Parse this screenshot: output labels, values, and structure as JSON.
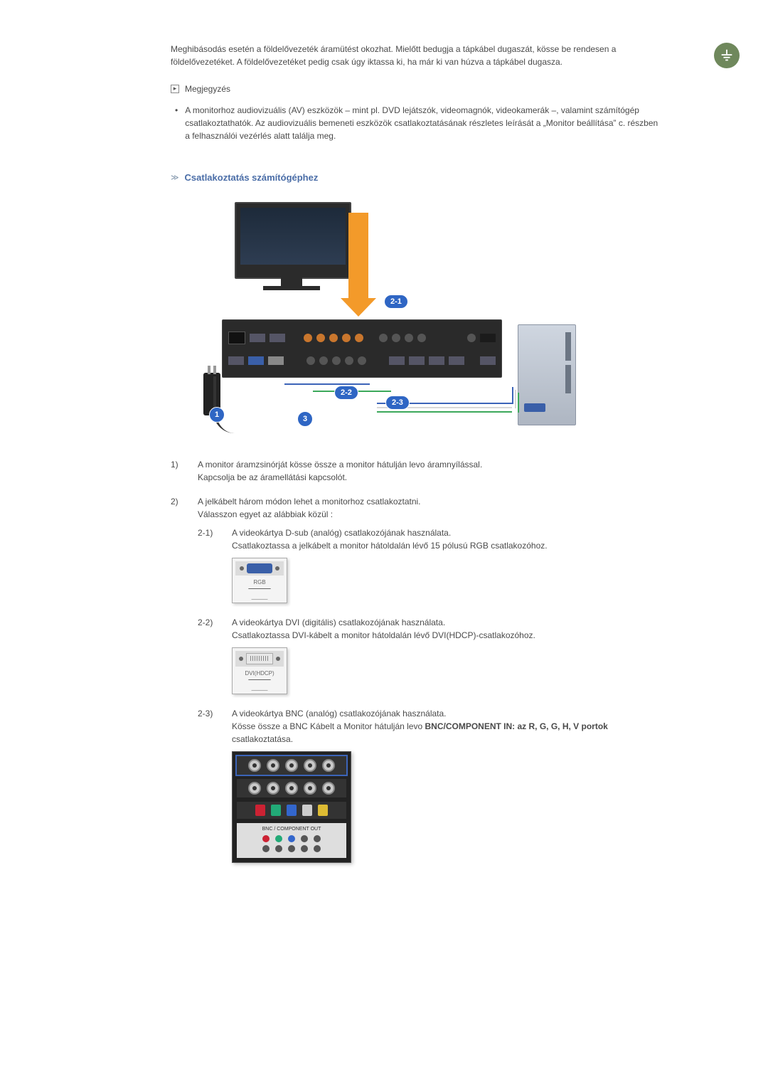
{
  "intro": "Meghibásodás esetén a földelővezeték áramütést okozhat. Mielőtt bedugja a tápkábel dugaszát, kösse be rendesen a földelővezetéket. A földelővezetéket pedig csak úgy iktassa ki, ha már ki van húzva a tápkábel dugasza.",
  "note_label": "Megjegyzés",
  "note_text": "A monitorhoz audiovizuális (AV) eszközök – mint pl. DVD lejátszók, videomagnók, videokamerák –, valamint számítógép csatlakoztathatók. Az audiovizuális bemeneti eszközök csatlakoztatásának részletes leírását a „Monitor beállítása” c. részben a felhasználói vezérlés alatt találja meg.",
  "section_title": "Csatlakoztatás számítógéphez",
  "diagram": {
    "badge_21": "2-1",
    "badge_22": "2-2",
    "badge_23": "2-3",
    "circ_1": "1",
    "circ_3": "3"
  },
  "list": {
    "item1": {
      "num": "1)",
      "line1": "A monitor áramzsinórját kösse össze a monitor hátulján levo áramnyílással.",
      "line2": "Kapcsolja be az áramellátási kapcsolót."
    },
    "item2": {
      "num": "2)",
      "line1": "A jelkábelt három módon lehet a monitorhoz csatlakoztatni.",
      "line2": "Válasszon egyet az alábbiak közül :",
      "sub": {
        "s21": {
          "num": "2-1)",
          "line1": "A videokártya D-sub (analóg) csatlakozójának használata.",
          "line2": "Csatlakoztassa a jelkábelt a monitor hátoldalán lévő 15 pólusú RGB csatlakozóhoz.",
          "thumb_label": "RGB"
        },
        "s22": {
          "num": "2-2)",
          "line1": "A videokártya DVI (digitális) csatlakozójának használata.",
          "line2": "Csatlakoztassa DVI-kábelt a monitor hátoldalán lévő DVI(HDCP)-csatlakozóhoz.",
          "thumb_label": "DVI(HDCP)"
        },
        "s23": {
          "num": "2-3)",
          "line1": "A videokártya BNC (analóg) csatlakozójának használata.",
          "line2_a": "Kösse össze a BNC Kábelt a Monitor hátulján levo ",
          "line2_bold": "BNC/COMPONENT IN: az R, G, G, H, V portok",
          "line2_b": " csatlakoztatása.",
          "panel_label": "BNC / COMPONENT OUT"
        }
      }
    }
  }
}
